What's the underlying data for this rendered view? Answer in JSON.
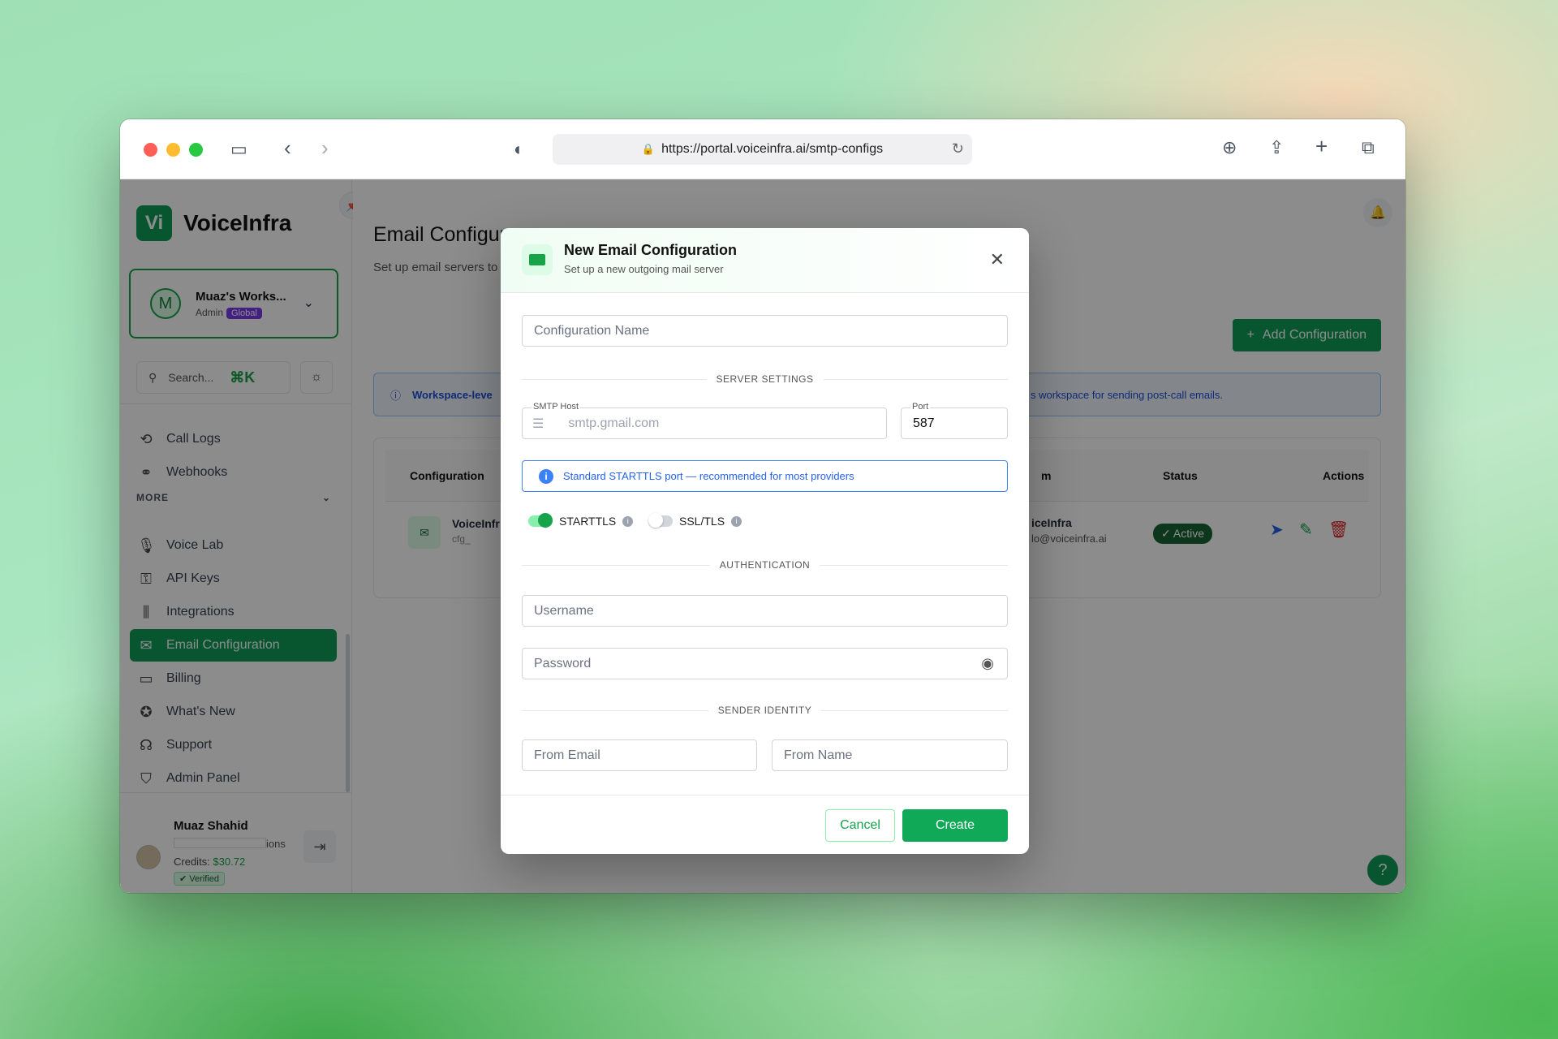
{
  "browser": {
    "url": "https://portal.voiceinfra.ai/smtp-configs"
  },
  "sidebar": {
    "brand": "VoiceInfra",
    "workspace": {
      "name": "Muaz's Works...",
      "role": "Admin",
      "badge": "Global",
      "avatar": "M"
    },
    "search": {
      "placeholder": "Search...",
      "shortcut": "⌘K"
    },
    "items_top": [
      {
        "label": "Call Logs",
        "icon": "history-icon"
      },
      {
        "label": "Webhooks",
        "icon": "webhook-icon"
      }
    ],
    "more_label": "MORE",
    "items_more": [
      {
        "label": "Voice Lab",
        "icon": "mic-icon"
      },
      {
        "label": "API Keys",
        "icon": "key-icon"
      },
      {
        "label": "Integrations",
        "icon": "integrations-icon"
      },
      {
        "label": "Email Configuration",
        "icon": "mail-icon",
        "active": true
      },
      {
        "label": "Billing",
        "icon": "card-icon"
      },
      {
        "label": "What's New",
        "icon": "news-icon"
      },
      {
        "label": "Support",
        "icon": "headset-icon"
      },
      {
        "label": "Admin Panel",
        "icon": "shield-icon"
      }
    ],
    "user": {
      "name": "Muaz Shahid",
      "email_suffix": "ions",
      "credits_label": "Credits:",
      "credits": "$30.72",
      "verified": "Verified"
    }
  },
  "page": {
    "title": "Email Configur",
    "subtitle": "Set up email servers to",
    "add_button": "Add Configuration",
    "info_title": "Workspace-leve",
    "info_text": "s workspace for sending post-call emails.",
    "table": {
      "headers": {
        "configuration": "Configuration",
        "from": "m",
        "status": "Status",
        "actions": "Actions"
      },
      "row": {
        "name": "VoiceInfr",
        "id": "cfg_",
        "from_name": "iceInfra",
        "from_email": "lo@voiceinfra.ai",
        "status": "Active"
      }
    }
  },
  "modal": {
    "title": "New Email Configuration",
    "subtitle": "Set up a new outgoing mail server",
    "config_name_placeholder": "Configuration Name",
    "section_server": "SERVER SETTINGS",
    "smtp_host_label": "SMTP Host",
    "smtp_host_placeholder": "smtp.gmail.com",
    "port_label": "Port",
    "port_value": "587",
    "hint": "Standard STARTTLS port — recommended for most providers",
    "starttls_label": "STARTTLS",
    "starttls_on": true,
    "ssltls_label": "SSL/TLS",
    "ssltls_on": false,
    "section_auth": "AUTHENTICATION",
    "username_placeholder": "Username",
    "password_placeholder": "Password",
    "section_sender": "SENDER IDENTITY",
    "from_email_placeholder": "From Email",
    "from_name_placeholder": "From Name",
    "cancel": "Cancel",
    "create": "Create"
  },
  "colors": {
    "brand": "#0f9d58",
    "info": "#2563eb",
    "danger": "#dc2626"
  }
}
